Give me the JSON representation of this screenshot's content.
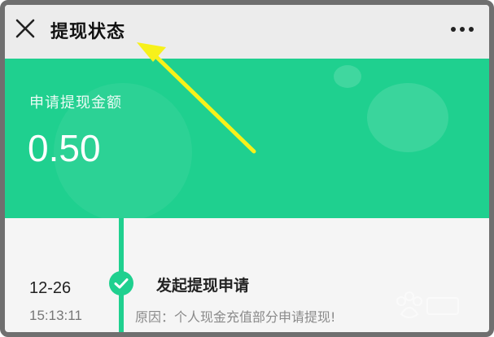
{
  "header": {
    "title": "提现状态",
    "close_icon": "close-icon",
    "more_icon": "more-icon"
  },
  "summary": {
    "label": "申请提现金额",
    "amount": "0.50",
    "background_color": "#1fd08f"
  },
  "timeline": {
    "events": [
      {
        "date": "12-26",
        "time": "15:13:11",
        "title": "发起提现申请",
        "reason": "原因：个人现金充值部分申请提现!"
      }
    ]
  },
  "annotation": {
    "arrow_color": "#f7f11a"
  }
}
